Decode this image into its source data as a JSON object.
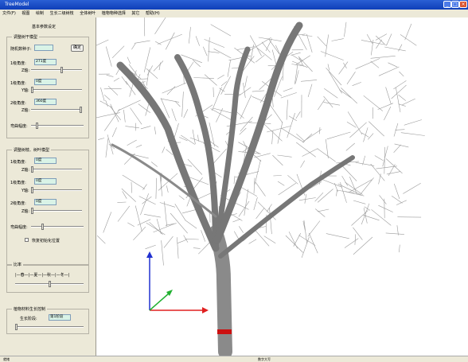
{
  "window": {
    "title": "TreeModel",
    "minimize_glyph": "_",
    "maximize_glyph": "□",
    "close_glyph": "×"
  },
  "menu": [
    "文件(F)",
    "视图",
    "绘制",
    "生长二级树枝",
    "全体树叶",
    "植物物种选择",
    "其它",
    "帮助(H)"
  ],
  "panel": {
    "title": "基本参数设定",
    "group1": {
      "label": "调整树干模型",
      "seed_label": "随机数种子:",
      "seed_value": "",
      "apply_label": "确定",
      "rows": [
        {
          "label": "1级角度:",
          "value": "271度",
          "axis": "Z轴:",
          "level": 0.6
        },
        {
          "label": "1级角度:",
          "value": "0度",
          "axis": "Y轴:",
          "level": 0.0
        },
        {
          "label": "2级角度:",
          "value": "360度",
          "axis": "Z轴:",
          "level": 1.0
        }
      ],
      "blend_label": "弯曲幅度:",
      "blend_level": 0.1
    },
    "group2": {
      "label": "调整树枝、树叶模型",
      "rows": [
        {
          "label": "1级角度:",
          "value": "0度",
          "axis": "Z轴:",
          "level": 0.0
        },
        {
          "label": "1级角度:",
          "value": "0度",
          "axis": "Y轴:",
          "level": 0.0
        },
        {
          "label": "2级角度:",
          "value": "0度",
          "axis": "Z轴:",
          "level": 0.0
        }
      ],
      "blend_label": "弯曲幅度:",
      "blend_level": 0.2,
      "checkbox_label": "恢复初始化位置"
    },
    "group3": {
      "label": "比率",
      "ticks": "|—春—|—夏—|—秋—|—冬—|",
      "level": 0.5
    },
    "group4": {
      "label": "植物材料生长控制",
      "growth_label": "生长阶段:",
      "growth_value": "第1阶段",
      "level": 0.0
    }
  },
  "status": {
    "left": "就绪",
    "right": "数字大写"
  },
  "colors": {
    "titlebar": "#1c4fc9",
    "panel": "#ece9d8",
    "field": "#d9f3e7",
    "trunk": "#7a7a7a",
    "band": "#cc1010",
    "axis_x": "#e02020",
    "axis_y": "#2030d0",
    "axis_z": "#20b030"
  }
}
